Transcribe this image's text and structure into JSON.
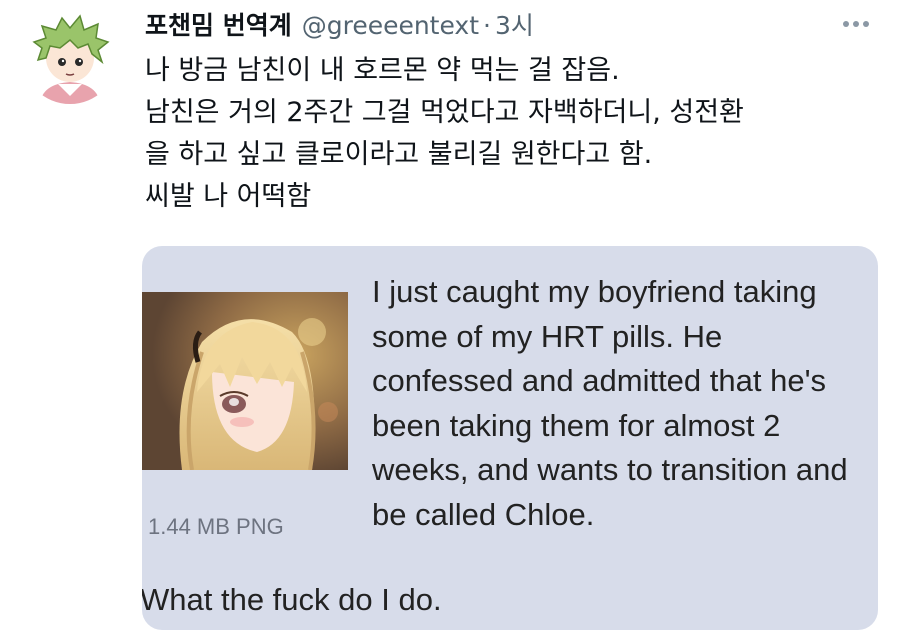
{
  "tweet": {
    "author_name": "포챈밈 번역계",
    "handle": "@greeeentext",
    "separator": "·",
    "time": "3시",
    "more_icon": "more-horizontal-icon",
    "text_lines": [
      "나 방금 남친이 내 호르몬 약 먹는 걸 잡음.",
      "남친은 거의 2주간 그걸 먹었다고 자백하더니, 성전환",
      "을 하고 싶고 클로이라고 불리길 원한다고 함.",
      "씨발 나 어떡함"
    ]
  },
  "attachment": {
    "file_info": "1.44 MB PNG",
    "post_lines": [
      "I just caught my boyfriend taking",
      "some of my HRT pills. He",
      "confessed and admitted that he's",
      "been taking them for almost 2",
      "weeks, and wants to transition and",
      "be called Chloe."
    ],
    "followup": "What the fuck do I do.",
    "background_color": "#d7dcea"
  }
}
